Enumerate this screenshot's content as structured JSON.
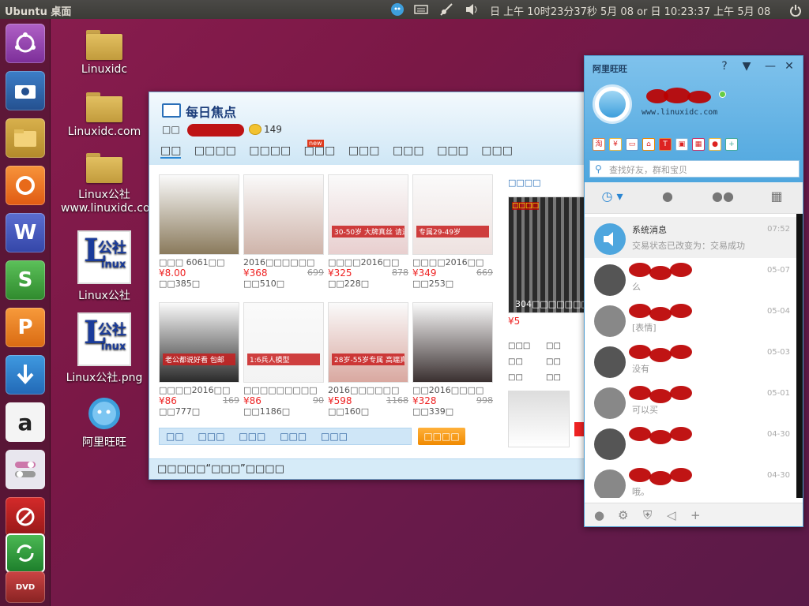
{
  "toppanel": {
    "title": "Ubuntu 桌面",
    "clock": "日 上午 10时23分37秒 5月 08 or 日 10:23:37 上午 5月 08"
  },
  "desktop_icons": [
    {
      "label": "Linuxidc"
    },
    {
      "label": "Linuxidc.com"
    },
    {
      "label": "Linux公社www.linuxidc.com"
    },
    {
      "label": "Linux公社"
    },
    {
      "label": "Linux公社.png"
    },
    {
      "label": "阿里旺旺"
    }
  ],
  "focus": {
    "title": "每日焦点",
    "user_line": "□□",
    "coins": "149",
    "tabs": [
      "□□",
      "□□□□",
      "□□□□",
      "□□□",
      "□□□",
      "□□□",
      "□□□",
      "□□□"
    ],
    "new_badge": "new",
    "products": [
      {
        "name": "□□□ 6061□□",
        "price": "¥8.00",
        "old": "",
        "sold": "□□385□",
        "color": "#8a7a5c",
        "caption": ""
      },
      {
        "name": "2016□□□□□□",
        "price": "¥368",
        "old": "699",
        "sold": "□□510□",
        "color": "#cfb4aa",
        "caption": ""
      },
      {
        "name": "□□□□2016□□",
        "price": "¥325",
        "old": "878",
        "sold": "□□228□",
        "color": "#e8cfcf",
        "caption": "30-50岁 大牌真丝 请进»"
      },
      {
        "name": "□□□□2016□□",
        "price": "¥349",
        "old": "669",
        "sold": "□□253□",
        "color": "#eee2e0",
        "caption": "专属29-49岁"
      },
      {
        "name": "□□□□2016□□",
        "price": "¥86",
        "old": "169",
        "sold": "□□777□",
        "color": "#2b2b2b",
        "caption": "老公都说好看 包邮"
      },
      {
        "name": "□□□□□□□□□",
        "price": "¥86",
        "old": "90",
        "sold": "□□1186□",
        "color": "#f3f3f3",
        "caption": "1:6兵人模型"
      },
      {
        "name": "2016□□□□□□",
        "price": "¥598",
        "old": "1168",
        "sold": "□□160□",
        "color": "#d9a8a0",
        "caption": "28岁-55岁专属 高端真丝连衣裙"
      },
      {
        "name": "□□2016□□□□",
        "price": "¥328",
        "old": "998",
        "sold": "□□339□",
        "color": "#3a3030",
        "caption": ""
      }
    ],
    "side_label": "□□□□",
    "side_caption": "304□□□□□□□",
    "side_price": "¥5",
    "side_links": [
      "□□□",
      "□□",
      "□□",
      "□□",
      "□□",
      "□□"
    ],
    "cats": [
      "□□",
      "□□□",
      "□□□",
      "□□□",
      "□□□"
    ],
    "more_button": "□□□□",
    "footer": "□□□□□“□□□”□□□□"
  },
  "ali": {
    "title": "阿里旺旺",
    "url": "www.linuxidc.com",
    "search_placeholder": "查找好友，群和宝贝",
    "contacts": [
      {
        "name": "系统消息",
        "msg": "交易状态已改变为：交易成功",
        "date": "07:52"
      },
      {
        "name": "",
        "msg": "么",
        "date": "05-07"
      },
      {
        "name": "",
        "msg": "[表情]",
        "date": "05-04"
      },
      {
        "name": "",
        "msg": "没有",
        "date": "05-03"
      },
      {
        "name": "",
        "msg": "可以买",
        "date": "05-01"
      },
      {
        "name": "",
        "msg": "",
        "date": "04-30"
      },
      {
        "name": "",
        "msg": "哦。",
        "date": "04-30"
      }
    ]
  }
}
